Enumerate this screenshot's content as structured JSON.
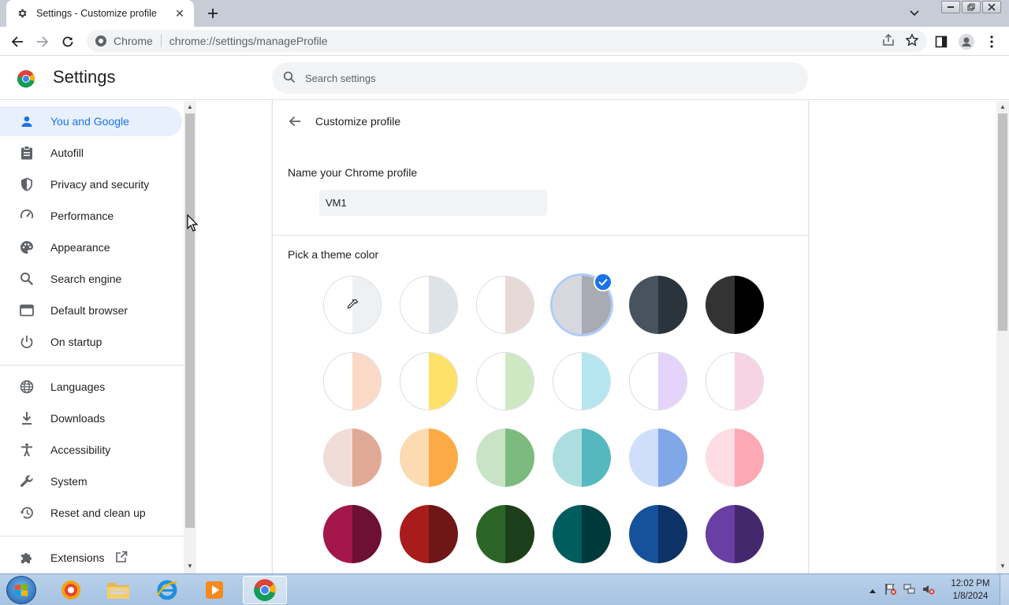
{
  "browser": {
    "tab_title": "Settings - Customize profile",
    "omnibox_chip": "Chrome",
    "url": "chrome://settings/manageProfile"
  },
  "settings": {
    "title": "Settings",
    "search_placeholder": "Search settings"
  },
  "sidebar": {
    "items": [
      {
        "label": "You and Google",
        "icon": "person-icon",
        "active": true
      },
      {
        "label": "Autofill",
        "icon": "clipboard-icon"
      },
      {
        "label": "Privacy and security",
        "icon": "shield-icon"
      },
      {
        "label": "Performance",
        "icon": "gauge-icon"
      },
      {
        "label": "Appearance",
        "icon": "palette-icon"
      },
      {
        "label": "Search engine",
        "icon": "search-icon"
      },
      {
        "label": "Default browser",
        "icon": "browser-window-icon"
      },
      {
        "label": "On startup",
        "icon": "power-icon"
      },
      {
        "label": "Languages",
        "icon": "globe-icon"
      },
      {
        "label": "Downloads",
        "icon": "download-icon"
      },
      {
        "label": "Accessibility",
        "icon": "accessibility-icon"
      },
      {
        "label": "System",
        "icon": "wrench-icon"
      },
      {
        "label": "Reset and clean up",
        "icon": "history-icon"
      },
      {
        "label": "Extensions",
        "icon": "puzzle-icon"
      }
    ]
  },
  "main": {
    "page_title": "Customize profile",
    "name_label": "Name your Chrome profile",
    "name_value": "VM1",
    "theme_label": "Pick a theme color",
    "selected_theme_index": 3,
    "theme_colors": [
      [
        "#ffffff",
        "#eef1f4"
      ],
      [
        "#ffffff",
        "#dee3ea"
      ],
      [
        "#ffffff",
        "#e6d9d6"
      ],
      [
        "#d6d8dd",
        "#a8abb3"
      ],
      [
        "#475460",
        "#2a343c"
      ],
      [
        "#333333",
        "#000000"
      ],
      [
        "#ffffff",
        "#fbd9c7"
      ],
      [
        "#ffffff",
        "#fde168"
      ],
      [
        "#ffffff",
        "#cfe8c4"
      ],
      [
        "#ffffff",
        "#b5e6ef"
      ],
      [
        "#ffffff",
        "#e5d3fb"
      ],
      [
        "#ffffff",
        "#f6d4e3"
      ],
      [
        "#f0ddd8",
        "#e0a996"
      ],
      [
        "#fcdbb2",
        "#fbaa45"
      ],
      [
        "#c8e3c6",
        "#7cbb7d"
      ],
      [
        "#addedf",
        "#56b8bf"
      ],
      [
        "#cfdffb",
        "#80a8e8"
      ],
      [
        "#fddde3",
        "#fca8b5"
      ],
      [
        "#a3174c",
        "#6e0f34"
      ],
      [
        "#a81c1c",
        "#6f1616"
      ],
      [
        "#2b6628",
        "#1c3e1a"
      ],
      [
        "#005d5f",
        "#00393c"
      ],
      [
        "#16529c",
        "#0d3266"
      ],
      [
        "#693fa3",
        "#44286d"
      ]
    ]
  },
  "taskbar": {
    "time": "12:02 PM",
    "date": "1/8/2024"
  },
  "colors": {
    "accent": "#1a73e8",
    "active_nav_bg": "#e8f0fe"
  }
}
